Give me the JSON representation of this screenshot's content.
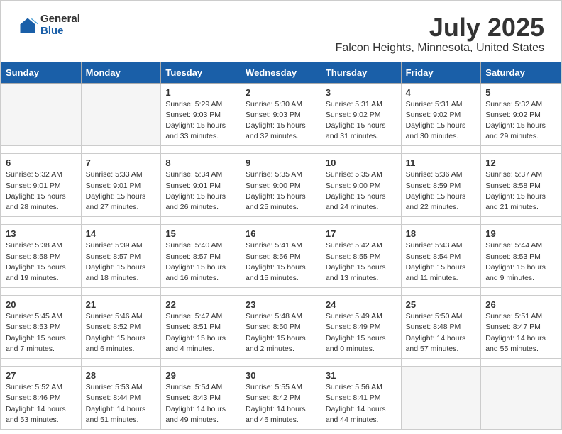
{
  "header": {
    "logo_general": "General",
    "logo_blue": "Blue",
    "title": "July 2025",
    "subtitle": "Falcon Heights, Minnesota, United States"
  },
  "weekdays": [
    "Sunday",
    "Monday",
    "Tuesday",
    "Wednesday",
    "Thursday",
    "Friday",
    "Saturday"
  ],
  "weeks": [
    [
      {
        "day": "",
        "info": ""
      },
      {
        "day": "",
        "info": ""
      },
      {
        "day": "1",
        "info": "Sunrise: 5:29 AM\nSunset: 9:03 PM\nDaylight: 15 hours\nand 33 minutes."
      },
      {
        "day": "2",
        "info": "Sunrise: 5:30 AM\nSunset: 9:03 PM\nDaylight: 15 hours\nand 32 minutes."
      },
      {
        "day": "3",
        "info": "Sunrise: 5:31 AM\nSunset: 9:02 PM\nDaylight: 15 hours\nand 31 minutes."
      },
      {
        "day": "4",
        "info": "Sunrise: 5:31 AM\nSunset: 9:02 PM\nDaylight: 15 hours\nand 30 minutes."
      },
      {
        "day": "5",
        "info": "Sunrise: 5:32 AM\nSunset: 9:02 PM\nDaylight: 15 hours\nand 29 minutes."
      }
    ],
    [
      {
        "day": "6",
        "info": "Sunrise: 5:32 AM\nSunset: 9:01 PM\nDaylight: 15 hours\nand 28 minutes."
      },
      {
        "day": "7",
        "info": "Sunrise: 5:33 AM\nSunset: 9:01 PM\nDaylight: 15 hours\nand 27 minutes."
      },
      {
        "day": "8",
        "info": "Sunrise: 5:34 AM\nSunset: 9:01 PM\nDaylight: 15 hours\nand 26 minutes."
      },
      {
        "day": "9",
        "info": "Sunrise: 5:35 AM\nSunset: 9:00 PM\nDaylight: 15 hours\nand 25 minutes."
      },
      {
        "day": "10",
        "info": "Sunrise: 5:35 AM\nSunset: 9:00 PM\nDaylight: 15 hours\nand 24 minutes."
      },
      {
        "day": "11",
        "info": "Sunrise: 5:36 AM\nSunset: 8:59 PM\nDaylight: 15 hours\nand 22 minutes."
      },
      {
        "day": "12",
        "info": "Sunrise: 5:37 AM\nSunset: 8:58 PM\nDaylight: 15 hours\nand 21 minutes."
      }
    ],
    [
      {
        "day": "13",
        "info": "Sunrise: 5:38 AM\nSunset: 8:58 PM\nDaylight: 15 hours\nand 19 minutes."
      },
      {
        "day": "14",
        "info": "Sunrise: 5:39 AM\nSunset: 8:57 PM\nDaylight: 15 hours\nand 18 minutes."
      },
      {
        "day": "15",
        "info": "Sunrise: 5:40 AM\nSunset: 8:57 PM\nDaylight: 15 hours\nand 16 minutes."
      },
      {
        "day": "16",
        "info": "Sunrise: 5:41 AM\nSunset: 8:56 PM\nDaylight: 15 hours\nand 15 minutes."
      },
      {
        "day": "17",
        "info": "Sunrise: 5:42 AM\nSunset: 8:55 PM\nDaylight: 15 hours\nand 13 minutes."
      },
      {
        "day": "18",
        "info": "Sunrise: 5:43 AM\nSunset: 8:54 PM\nDaylight: 15 hours\nand 11 minutes."
      },
      {
        "day": "19",
        "info": "Sunrise: 5:44 AM\nSunset: 8:53 PM\nDaylight: 15 hours\nand 9 minutes."
      }
    ],
    [
      {
        "day": "20",
        "info": "Sunrise: 5:45 AM\nSunset: 8:53 PM\nDaylight: 15 hours\nand 7 minutes."
      },
      {
        "day": "21",
        "info": "Sunrise: 5:46 AM\nSunset: 8:52 PM\nDaylight: 15 hours\nand 6 minutes."
      },
      {
        "day": "22",
        "info": "Sunrise: 5:47 AM\nSunset: 8:51 PM\nDaylight: 15 hours\nand 4 minutes."
      },
      {
        "day": "23",
        "info": "Sunrise: 5:48 AM\nSunset: 8:50 PM\nDaylight: 15 hours\nand 2 minutes."
      },
      {
        "day": "24",
        "info": "Sunrise: 5:49 AM\nSunset: 8:49 PM\nDaylight: 15 hours\nand 0 minutes."
      },
      {
        "day": "25",
        "info": "Sunrise: 5:50 AM\nSunset: 8:48 PM\nDaylight: 14 hours\nand 57 minutes."
      },
      {
        "day": "26",
        "info": "Sunrise: 5:51 AM\nSunset: 8:47 PM\nDaylight: 14 hours\nand 55 minutes."
      }
    ],
    [
      {
        "day": "27",
        "info": "Sunrise: 5:52 AM\nSunset: 8:46 PM\nDaylight: 14 hours\nand 53 minutes."
      },
      {
        "day": "28",
        "info": "Sunrise: 5:53 AM\nSunset: 8:44 PM\nDaylight: 14 hours\nand 51 minutes."
      },
      {
        "day": "29",
        "info": "Sunrise: 5:54 AM\nSunset: 8:43 PM\nDaylight: 14 hours\nand 49 minutes."
      },
      {
        "day": "30",
        "info": "Sunrise: 5:55 AM\nSunset: 8:42 PM\nDaylight: 14 hours\nand 46 minutes."
      },
      {
        "day": "31",
        "info": "Sunrise: 5:56 AM\nSunset: 8:41 PM\nDaylight: 14 hours\nand 44 minutes."
      },
      {
        "day": "",
        "info": ""
      },
      {
        "day": "",
        "info": ""
      }
    ]
  ]
}
